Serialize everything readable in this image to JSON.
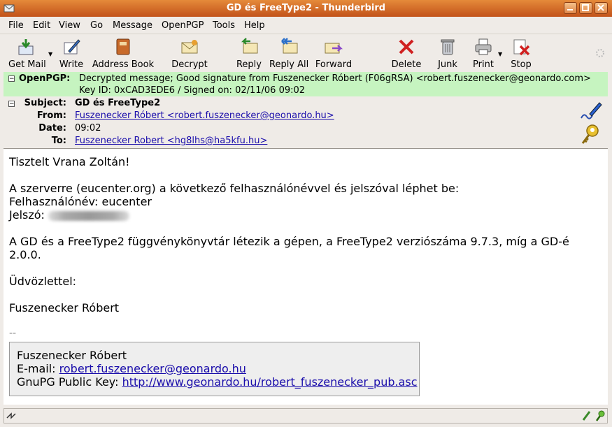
{
  "window": {
    "title": "GD és FreeType2 - Thunderbird"
  },
  "menu": [
    "File",
    "Edit",
    "View",
    "Go",
    "Message",
    "OpenPGP",
    "Tools",
    "Help"
  ],
  "toolbar": {
    "get_mail": "Get Mail",
    "write": "Write",
    "address_book": "Address Book",
    "decrypt": "Decrypt",
    "reply": "Reply",
    "reply_all": "Reply All",
    "forward": "Forward",
    "delete": "Delete",
    "junk": "Junk",
    "print": "Print",
    "stop": "Stop"
  },
  "openpgp": {
    "label": "OpenPGP:",
    "line1": "Decrypted message; Good signature from Fuszenecker Róbert (F06gRSA) <robert.fuszenecker@geonardo.com>",
    "line2": "Key ID: 0xCAD3EDE6 / Signed on: 02/11/06 09:02"
  },
  "headers": {
    "subject_label": "Subject:",
    "subject": "GD és FreeType2",
    "from_label": "From:",
    "from": "Fuszenecker Róbert <robert.fuszenecker@geonardo.hu>",
    "date_label": "Date:",
    "date": "09:02",
    "to_label": "To:",
    "to": "Fuszenecker Robert <hg8lhs@ha5kfu.hu>"
  },
  "body": {
    "greeting": "Tisztelt Vrana Zoltán!",
    "p1": "A szerverre (eucenter.org) a következő felhasználónévvel és jelszóval léphet be:",
    "p2": "Felhasználónév: eucenter",
    "p3": "Jelszó:",
    "p4a": "A GD és a FreeType2 függvénykönyvtár létezik a gépen, a FreeType2 verziószáma  9.7.3, míg a GD-é",
    "p4b": "2.0.0.",
    "closing": "Üdvözlettel:",
    "name": "Fuszenecker Róbert",
    "sig_sep": "--"
  },
  "signature": {
    "name": "Fuszenecker Róbert",
    "email_label": "E-mail:",
    "email": "robert.fuszenecker@geonardo.hu",
    "key_label": "GnuPG Public Key:",
    "key_url": "http://www.geonardo.hu/robert_fuszenecker_pub.asc"
  },
  "icons": [
    "mail-icon",
    "pen-icon",
    "book-icon",
    "envelope-icon",
    "reply-icon",
    "reply-all-icon",
    "forward-icon",
    "delete-icon",
    "trash-icon",
    "printer-icon",
    "stop-icon",
    "signature-pen-icon",
    "key-icon",
    "throbber-icon"
  ]
}
